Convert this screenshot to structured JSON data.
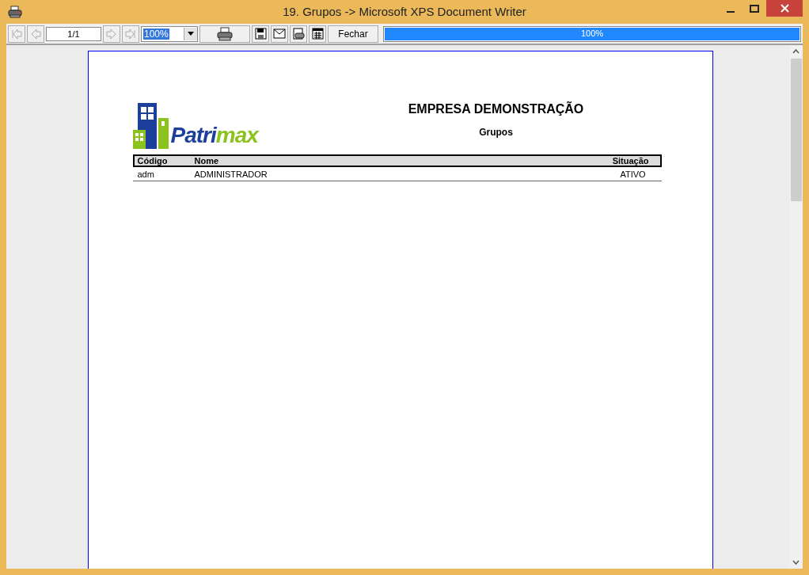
{
  "window": {
    "title": "19. Grupos -> Microsoft XPS Document Writer"
  },
  "toolbar": {
    "page_field": "1/1",
    "zoom": "100%",
    "close_button": "Fechar",
    "progress": {
      "level": 1.0,
      "reading": "100%"
    }
  },
  "report": {
    "logo": {
      "part_1": "Patri",
      "part_2": "max"
    },
    "company": "EMPRESA DEMONSTRAÇÃO",
    "title": "Grupos",
    "columns": [
      "Código",
      "Nome",
      "Situação"
    ],
    "rows": [
      {
        "code": "adm",
        "name": "ADMINISTRADOR",
        "status": "ATIVO"
      }
    ]
  }
}
